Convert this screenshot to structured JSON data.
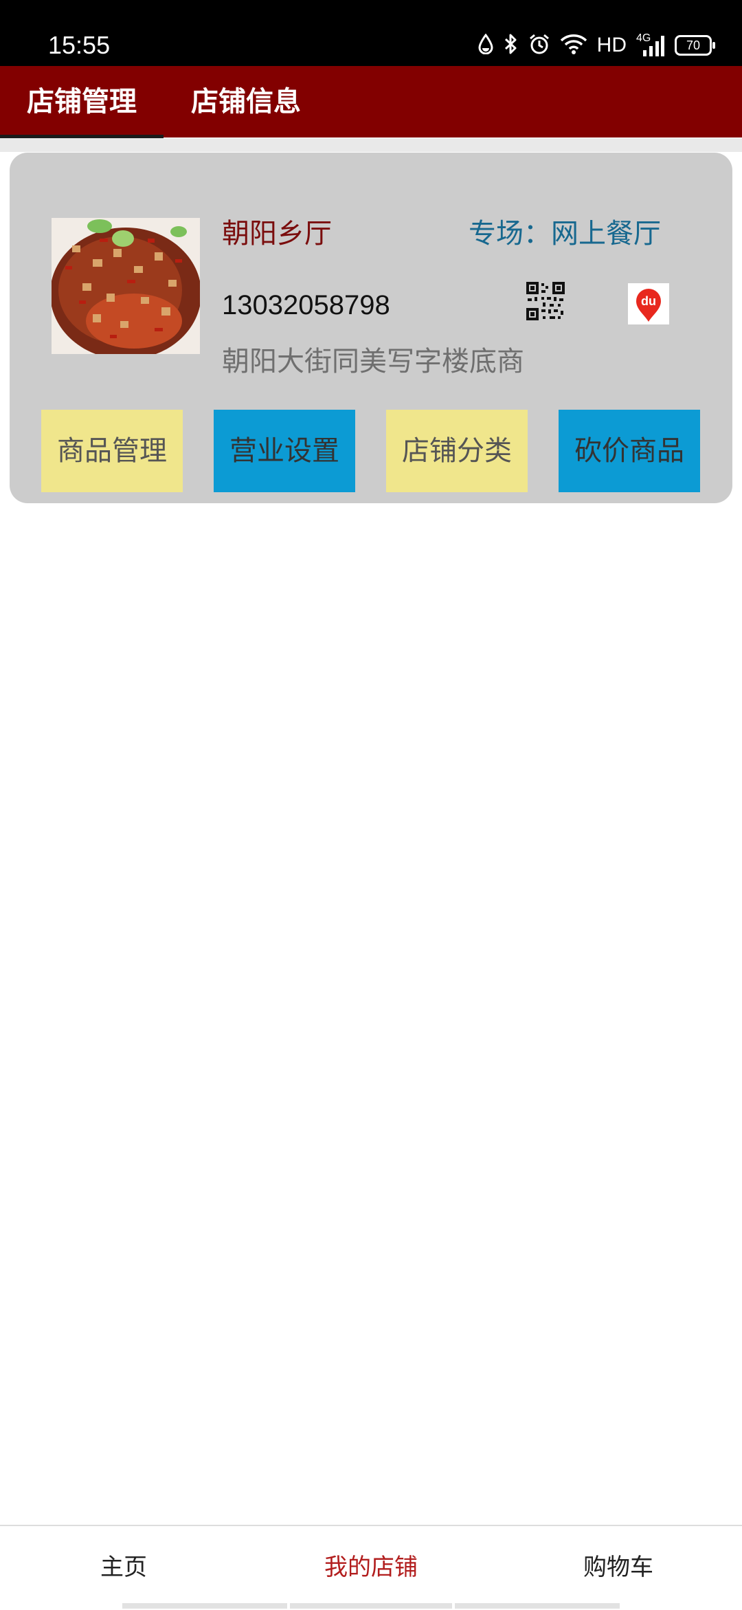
{
  "status_bar": {
    "time": "15:55",
    "network_label": "HD",
    "cell_label": "4G",
    "battery_level": "70",
    "icons": [
      "water-drop-icon",
      "bluetooth-icon",
      "alarm-icon",
      "wifi-icon",
      "signal-icon",
      "battery-icon"
    ]
  },
  "header": {
    "tabs": [
      {
        "label": "店铺管理",
        "active": true
      },
      {
        "label": "店铺信息",
        "active": false
      }
    ]
  },
  "shop": {
    "name": "朝阳乡厅",
    "category": "专场：网上餐厅",
    "phone": "13032058798",
    "address": "朝阳大街同美写字楼底商",
    "photo_icon": "food-dish-photo",
    "qr_icon": "qr-code-icon",
    "map_icon": "baidu-map-icon",
    "map_icon_text": "du"
  },
  "actions": [
    {
      "label": "商品管理",
      "color": "#f0e68c"
    },
    {
      "label": "营业设置",
      "color": "#0c9bd4"
    },
    {
      "label": "店铺分类",
      "color": "#f0e68c"
    },
    {
      "label": "砍价商品",
      "color": "#0c9bd4"
    }
  ],
  "bottom_nav": {
    "items": [
      {
        "label": "主页",
        "active": false
      },
      {
        "label": "我的店铺",
        "active": true
      },
      {
        "label": "购物车",
        "active": false
      }
    ]
  },
  "colors": {
    "header_bg": "#820000",
    "accent_red": "#b21e1e",
    "card_bg": "#cccccc",
    "category_blue": "#17688f"
  }
}
